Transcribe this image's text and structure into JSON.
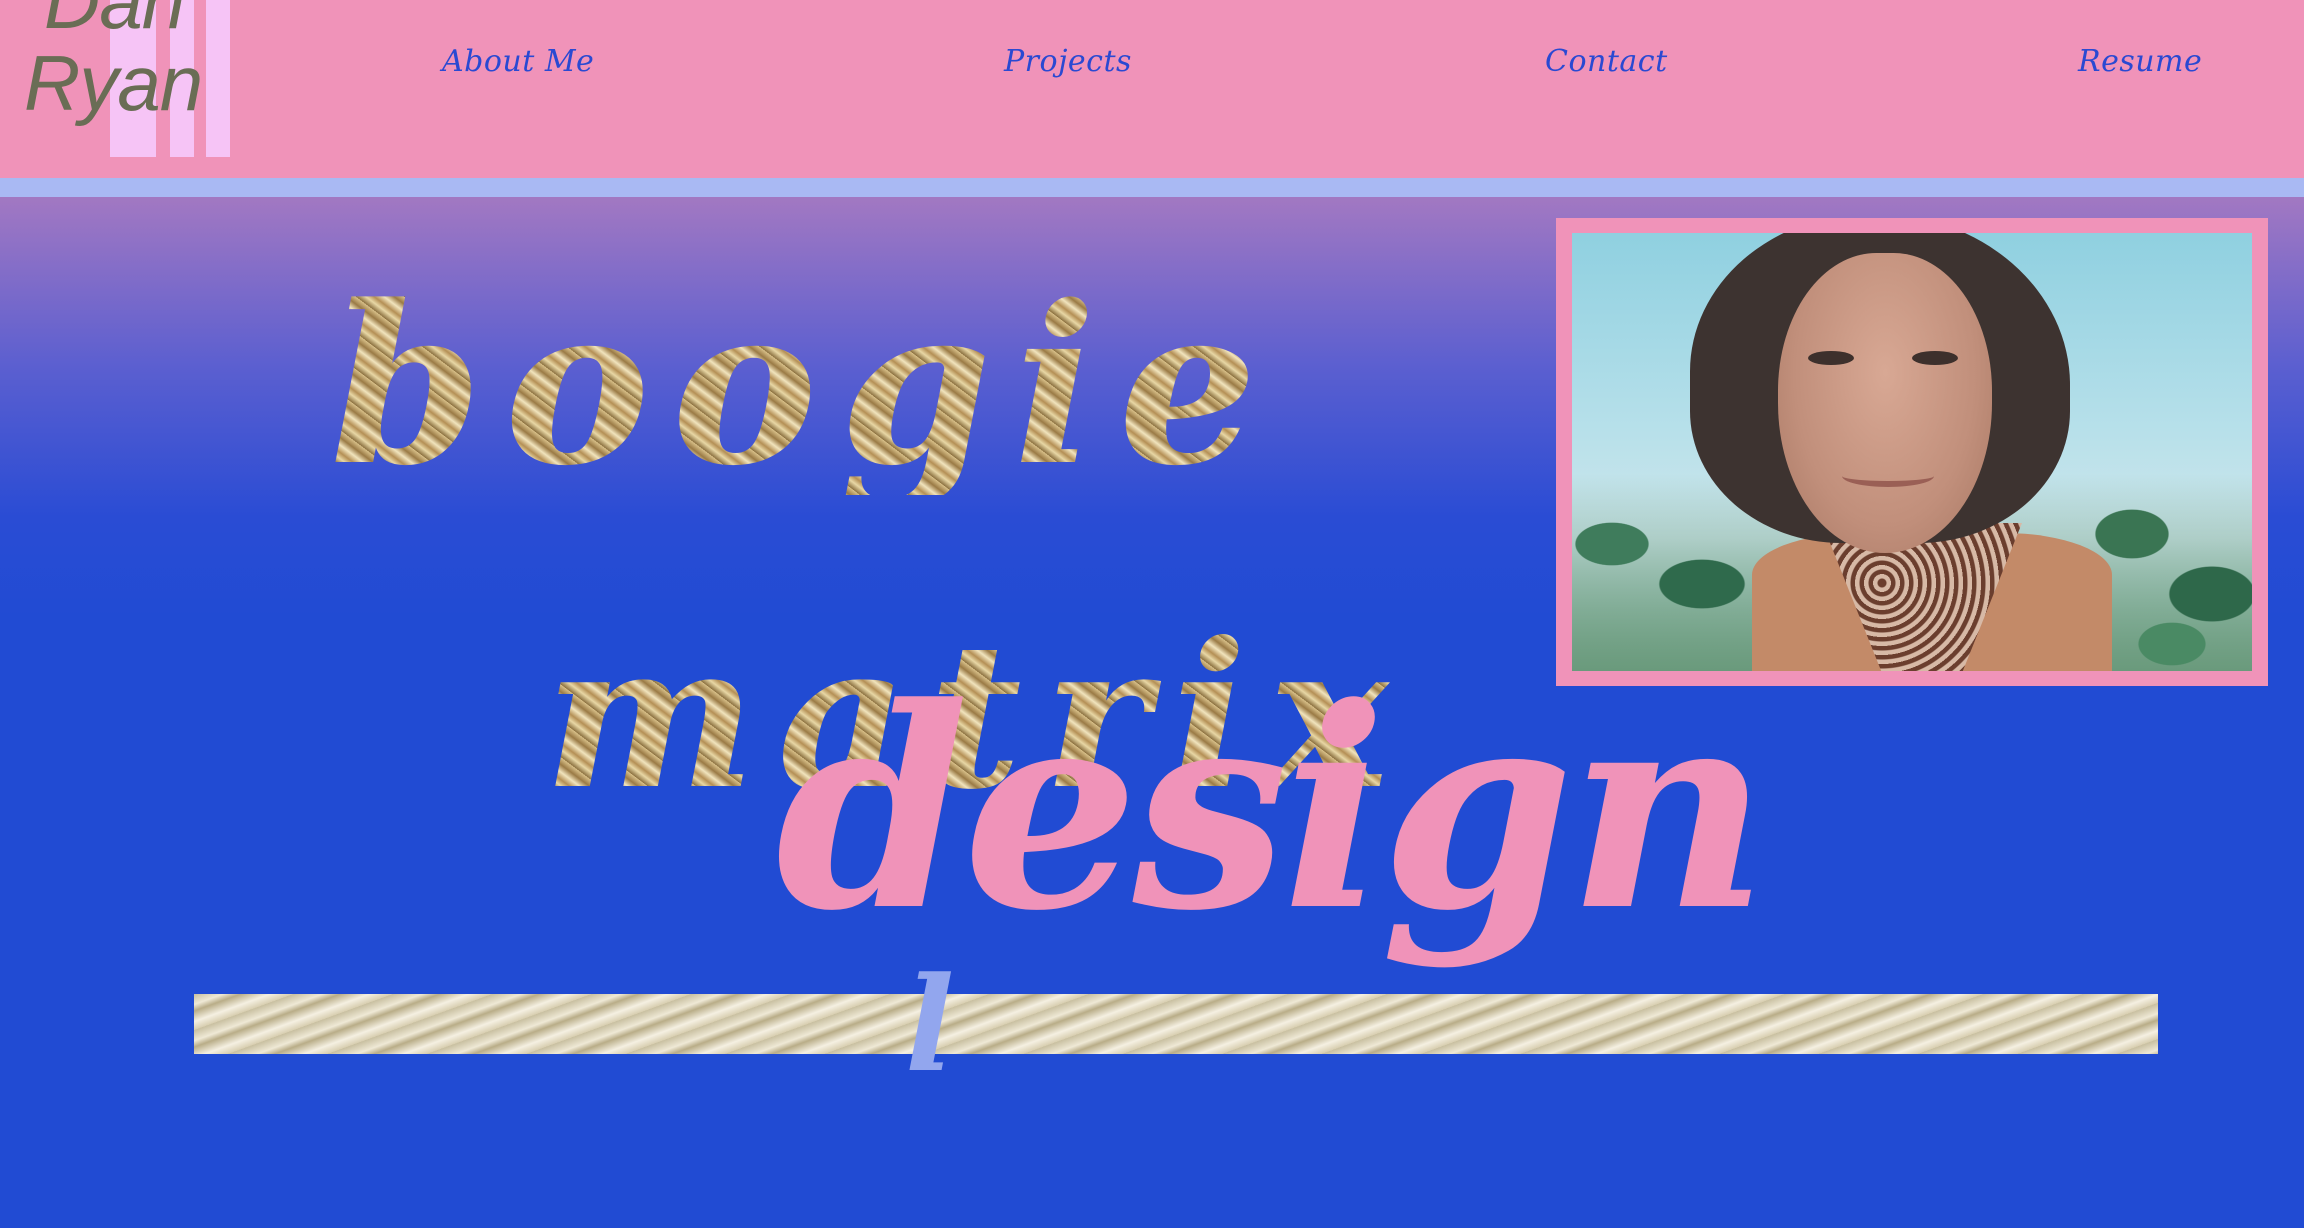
{
  "site": {
    "logo_line1": "Dan",
    "logo_line2": "Ryan"
  },
  "nav": {
    "items": [
      {
        "label": "About Me"
      },
      {
        "label": "Projects"
      },
      {
        "label": "Contact"
      },
      {
        "label": "Resume"
      }
    ]
  },
  "hero": {
    "word1": "boogie",
    "word2": "matrix",
    "word3": "design",
    "partial_letter": "l"
  },
  "colors": {
    "header_bg": "#f093b9",
    "header_stripe": "#a9b9f3",
    "main_bg": "#214bd3",
    "nav_text": "#2a49d2",
    "accent_pink": "#f093b9",
    "logo_bar": "#f6c4f6",
    "logo_text": "#6a6d55"
  }
}
